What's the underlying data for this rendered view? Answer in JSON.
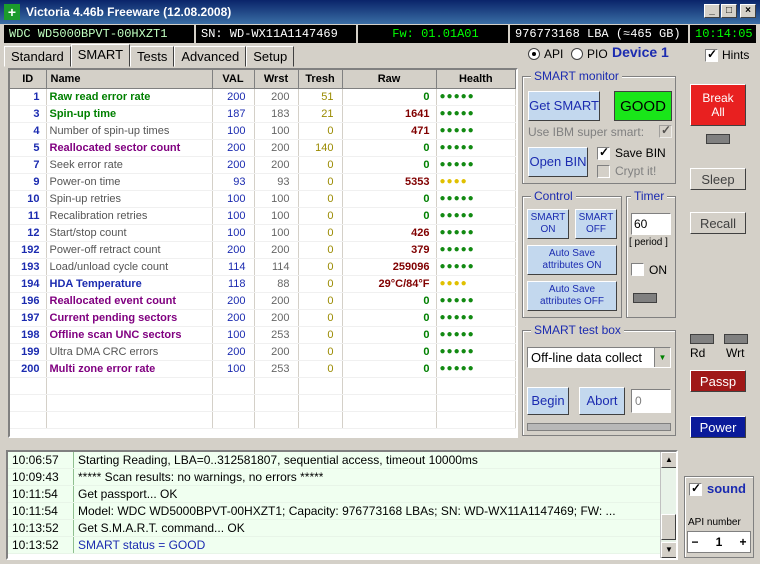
{
  "window": {
    "title": "Victoria 4.46b Freeware (12.08.2008)",
    "controls": [
      "_",
      "□",
      "×"
    ]
  },
  "info": {
    "model": "WDC WD5000BPVT-00HXZT1",
    "serial": "SN: WD-WX11A1147469",
    "firmware": "Fw: 01.01A01",
    "capacity": "976773168 LBA (≈465 GB)",
    "clock": "10:14:05"
  },
  "tabs": [
    "Standard",
    "SMART",
    "Tests",
    "Advanced",
    "Setup"
  ],
  "active_tab": "SMART",
  "mode": {
    "api": "API",
    "pio": "PIO",
    "selected": "API"
  },
  "device": "Device 1",
  "hints_label": "Hints",
  "smart_table": {
    "headers": [
      "ID",
      "Name",
      "VAL",
      "Wrst",
      "Tresh",
      "Raw",
      "Health"
    ],
    "rows": [
      {
        "id": "1",
        "name": "Raw read error rate",
        "val": "200",
        "wrst": "200",
        "tresh": "51",
        "raw": "0",
        "health": "●●●●●",
        "style": "g",
        "hc": "green"
      },
      {
        "id": "3",
        "name": "Spin-up time",
        "val": "187",
        "wrst": "183",
        "tresh": "21",
        "raw": "1641",
        "health": "●●●●●",
        "style": "g",
        "hc": "green"
      },
      {
        "id": "4",
        "name": "Number of spin-up times",
        "val": "100",
        "wrst": "100",
        "tresh": "0",
        "raw": "471",
        "health": "●●●●●",
        "style": "n",
        "hc": "green"
      },
      {
        "id": "5",
        "name": "Reallocated sector count",
        "val": "200",
        "wrst": "200",
        "tresh": "140",
        "raw": "0",
        "health": "●●●●●",
        "style": "p",
        "hc": "green"
      },
      {
        "id": "7",
        "name": "Seek error rate",
        "val": "200",
        "wrst": "200",
        "tresh": "0",
        "raw": "0",
        "health": "●●●●●",
        "style": "n",
        "hc": "green"
      },
      {
        "id": "9",
        "name": "Power-on time",
        "val": "93",
        "wrst": "93",
        "tresh": "0",
        "raw": "5353",
        "health": "●●●●",
        "style": "n",
        "hc": "yellow"
      },
      {
        "id": "10",
        "name": "Spin-up retries",
        "val": "100",
        "wrst": "100",
        "tresh": "0",
        "raw": "0",
        "health": "●●●●●",
        "style": "n",
        "hc": "green"
      },
      {
        "id": "11",
        "name": "Recalibration retries",
        "val": "100",
        "wrst": "100",
        "tresh": "0",
        "raw": "0",
        "health": "●●●●●",
        "style": "n",
        "hc": "green"
      },
      {
        "id": "12",
        "name": "Start/stop count",
        "val": "100",
        "wrst": "100",
        "tresh": "0",
        "raw": "426",
        "health": "●●●●●",
        "style": "n",
        "hc": "green"
      },
      {
        "id": "192",
        "name": "Power-off retract count",
        "val": "200",
        "wrst": "200",
        "tresh": "0",
        "raw": "379",
        "health": "●●●●●",
        "style": "n",
        "hc": "green"
      },
      {
        "id": "193",
        "name": "Load/unload cycle count",
        "val": "114",
        "wrst": "114",
        "tresh": "0",
        "raw": "259096",
        "health": "●●●●●",
        "style": "n",
        "hc": "green"
      },
      {
        "id": "194",
        "name": "HDA Temperature",
        "val": "118",
        "wrst": "88",
        "tresh": "0",
        "raw": "29°C/84°F",
        "health": "●●●●",
        "style": "b",
        "hc": "yellow"
      },
      {
        "id": "196",
        "name": "Reallocated event count",
        "val": "200",
        "wrst": "200",
        "tresh": "0",
        "raw": "0",
        "health": "●●●●●",
        "style": "p",
        "hc": "green"
      },
      {
        "id": "197",
        "name": "Current pending sectors",
        "val": "200",
        "wrst": "200",
        "tresh": "0",
        "raw": "0",
        "health": "●●●●●",
        "style": "p",
        "hc": "green"
      },
      {
        "id": "198",
        "name": "Offline scan UNC sectors",
        "val": "100",
        "wrst": "253",
        "tresh": "0",
        "raw": "0",
        "health": "●●●●●",
        "style": "p",
        "hc": "green"
      },
      {
        "id": "199",
        "name": "Ultra DMA CRC errors",
        "val": "200",
        "wrst": "200",
        "tresh": "0",
        "raw": "0",
        "health": "●●●●●",
        "style": "n",
        "hc": "green"
      },
      {
        "id": "200",
        "name": "Multi zone error rate",
        "val": "100",
        "wrst": "253",
        "tresh": "0",
        "raw": "0",
        "health": "●●●●●",
        "style": "p",
        "hc": "green"
      }
    ]
  },
  "smart_monitor": {
    "title": "SMART monitor",
    "get_smart": "Get SMART",
    "status": "GOOD",
    "ibm_label": "Use IBM super smart:",
    "open_bin": "Open BIN",
    "save_bin": "Save BIN",
    "crypt": "Crypt it!"
  },
  "control": {
    "title": "Control",
    "smart_on": "SMART ON",
    "smart_off": "SMART OFF",
    "autosave_on": "Auto Save attributes ON",
    "autosave_off": "Auto Save attributes OFF"
  },
  "timer": {
    "title": "Timer",
    "value": "60",
    "period": "[ period ]",
    "on_label": "ON"
  },
  "test_box": {
    "title": "SMART test box",
    "selected": "Off-line data collect",
    "begin": "Begin",
    "abort": "Abort",
    "field": "0"
  },
  "sidebar": {
    "break_all": "Break All",
    "sleep": "Sleep",
    "recall": "Recall",
    "rd": "Rd",
    "wrt": "Wrt",
    "passp": "Passp",
    "power": "Power",
    "sound": "sound",
    "api_number_label": "API number",
    "api_number": "1"
  },
  "log": [
    {
      "time": "10:06:57",
      "msg": "Starting Reading, LBA=0..312581807, sequential access, timeout 10000ms",
      "color": "#000000"
    },
    {
      "time": "10:09:43",
      "msg": "***** Scan results: no warnings, no errors *****",
      "color": "#000000"
    },
    {
      "time": "10:11:54",
      "msg": "Get passport... OK",
      "color": "#000000"
    },
    {
      "time": "10:11:54",
      "msg": "Model: WDC WD5000BPVT-00HXZT1; Capacity: 976773168 LBAs; SN: WD-WX11A1147469; FW: ...",
      "color": "#000000"
    },
    {
      "time": "10:13:52",
      "msg": "Get S.M.A.R.T. command... OK",
      "color": "#000000"
    },
    {
      "time": "10:13:52",
      "msg": "SMART status = GOOD",
      "color": "#1b2bb0"
    }
  ]
}
